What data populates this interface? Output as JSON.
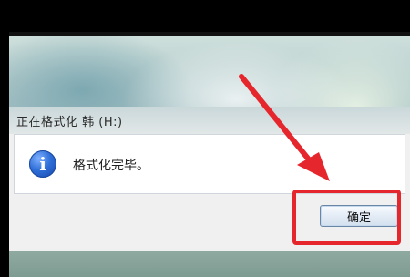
{
  "dialog": {
    "title": "正在格式化 韩 (H:)",
    "message": "格式化完毕。",
    "ok_label": "确定"
  },
  "icons": {
    "info": "info-icon",
    "info_glyph": "i",
    "arrow": "annotation-arrow"
  },
  "colors": {
    "annotation": "#e5262c",
    "dialog_bg": "#f0f0f0",
    "content_bg": "#ffffff"
  }
}
